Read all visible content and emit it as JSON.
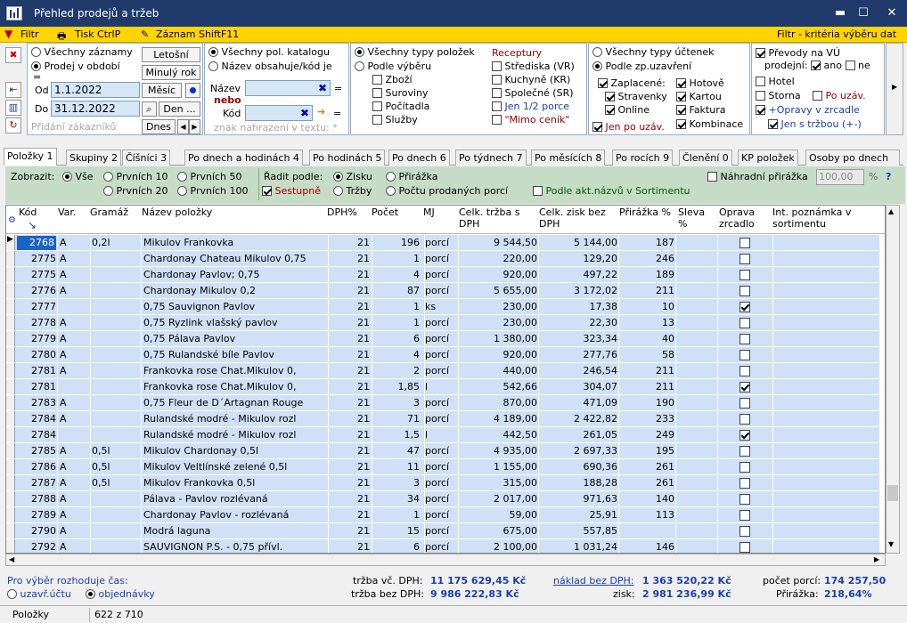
{
  "window": {
    "title": "Přehled prodejů a tržeb",
    "min": "▬",
    "max": "☐",
    "close": "✕"
  },
  "menu": {
    "filter": "Filtr",
    "print": "Tisk CtrlP",
    "record": "Záznam ShiftF11",
    "right": "Filtr - kritéria výběru dat"
  },
  "p1": {
    "all": "Všechny záznamy",
    "period": "Prodej v období",
    "ytd": "Letošní",
    "lastyear": "Minulý rok",
    "month": "Měsíc",
    "day": "Den ...",
    "today": "Dnes",
    "from_label": "Od",
    "to_label": "Do",
    "from": "1.1.2022",
    "to": "31.12.2022",
    "addcust": "Přidání zákazníků",
    "eq": "="
  },
  "p2": {
    "allcat": "Všechny pol. katalogu",
    "contains": "Název obsahuje/kód je",
    "name": "Název",
    "or": "nebo",
    "code": "Kód",
    "hint": "znak nahrazení v textu: *"
  },
  "p3": {
    "alltypes": "Všechny typy položek",
    "bysel": "Podle výběru",
    "goods": "Zboží",
    "raw": "Suroviny",
    "counters": "Počítadla",
    "services": "Služby",
    "recipes": "Receptury",
    "centers": "Střediska (VR)",
    "kitchen": "Kuchyně  (KR)",
    "common": "Společné (SR)",
    "half": "Jen 1/2 porce",
    "offmenu": "\"Mimo ceník\""
  },
  "p4": {
    "allbills": "Všechny typy účtenek",
    "bystate": "Podle zp.uzavření",
    "paid": "Zaplacené:",
    "meal": "Stravenky",
    "online": "Online",
    "cash": "Hotově",
    "card": "Kartou",
    "invoice": "Faktura",
    "combo": "Kombinace",
    "onlybill": "Jen po uzáv."
  },
  "p5": {
    "transfer": "Převody na VÚ",
    "sales": "prodejní:",
    "yes": "ano",
    "no": "ne",
    "hotel": "Hotel",
    "storno": "Storna",
    "after": "Po uzáv.",
    "fixes": "+Opravy v zrcadle",
    "withrev": "Jen s tržbou (+-)"
  },
  "tabs": [
    "Položky 1",
    "Skupiny 2",
    "Číšníci 3",
    "Po dnech a hodinách 4",
    "Po hodinách 5",
    "Po dnech 6",
    "Po týdnech 7",
    "Po měsících 8",
    "Po rocích 9",
    "Členění 0",
    "KP položek",
    "Osoby po dnech"
  ],
  "options": {
    "show": "Zobrazit:",
    "all": "Vše",
    "f10": "Prvních 10",
    "f20": "Prvních 20",
    "f50": "Prvních 50",
    "f100": "Prvních 100",
    "sort": "Řadit podle:",
    "desc": "Sestupně",
    "profit": "Zisku",
    "rev": "Tržby",
    "markup": "Přirážka",
    "count": "Počtu prodaných porcí",
    "actual": "Podle akt.názvů v Sortimentu",
    "altmarkup": "Náhradní přirážka",
    "altval": "100,00",
    "pct": "%",
    "help": "?"
  },
  "columns": [
    "Kód",
    "Var.",
    "Gramáž",
    "Název položky",
    "DPH%",
    "Počet",
    "MJ",
    "Celk. tržba s DPH",
    "Celk. zisk bez DPH",
    "Přirážka %",
    "Sleva %",
    "Oprava zrcadlo",
    "Int. poznámka v sortimentu"
  ],
  "rows": [
    [
      "2768",
      "A",
      "0,2l",
      "Mikulov Frankovka",
      "21",
      "196",
      "porcí",
      "9 544,50",
      "5 144,00",
      "187",
      "",
      false
    ],
    [
      "2775",
      "A",
      "",
      "Chardonay Chateau Mikulov 0,75",
      "21",
      "1",
      "porcí",
      "220,00",
      "129,20",
      "246",
      "",
      false
    ],
    [
      "2775",
      "A",
      "",
      "Chardonay Pavlov; 0,75",
      "21",
      "4",
      "porcí",
      "920,00",
      "497,22",
      "189",
      "",
      false
    ],
    [
      "2776",
      "A",
      "",
      "Chardonay Mikulov 0,2",
      "21",
      "87",
      "porcí",
      "5 655,00",
      "3 172,02",
      "211",
      "",
      false
    ],
    [
      "2777",
      "",
      "",
      "0,75 Sauvignon Pavlov",
      "21",
      "1",
      "ks",
      "230,00",
      "17,38",
      "10",
      "",
      true
    ],
    [
      "2778",
      "A",
      "",
      "0,75 Ryzlink vlašský pavlov",
      "21",
      "1",
      "porcí",
      "230,00",
      "22,30",
      "13",
      "",
      false
    ],
    [
      "2779",
      "A",
      "",
      "0,75 Pálava Pavlov",
      "21",
      "6",
      "porcí",
      "1 380,00",
      "323,34",
      "40",
      "",
      false
    ],
    [
      "2780",
      "A",
      "",
      "0,75 Rulandské bíle Pavlov",
      "21",
      "4",
      "porcí",
      "920,00",
      "277,76",
      "58",
      "",
      false
    ],
    [
      "2781",
      "A",
      "",
      "Frankovka rose Chat.Mikulov 0,",
      "21",
      "2",
      "porcí",
      "440,00",
      "246,54",
      "211",
      "",
      false
    ],
    [
      "2781",
      "",
      "",
      "Frankovka rose Chat.Mikulov 0,",
      "21",
      "1,85",
      "l",
      "542,66",
      "304,07",
      "211",
      "",
      true
    ],
    [
      "2783",
      "A",
      "",
      "0,75 Fleur de D´Artagnan Rouge",
      "21",
      "3",
      "porcí",
      "870,00",
      "471,09",
      "190",
      "",
      false
    ],
    [
      "2784",
      "A",
      "",
      "Rulandské modré - Mikulov rozl",
      "21",
      "71",
      "porcí",
      "4 189,00",
      "2 422,82",
      "233",
      "",
      false
    ],
    [
      "2784",
      "",
      "",
      "Rulandské modré - Mikulov rozl",
      "21",
      "1,5",
      "l",
      "442,50",
      "261,05",
      "249",
      "",
      true
    ],
    [
      "2785",
      "A",
      "0,5l",
      "Mikulov Chardonay 0,5l",
      "21",
      "47",
      "porcí",
      "4 935,00",
      "2 697,33",
      "195",
      "",
      false
    ],
    [
      "2786",
      "A",
      "0,5l",
      "Mikulov Veltlínské zelené 0,5l",
      "21",
      "11",
      "porcí",
      "1 155,00",
      "690,36",
      "261",
      "",
      false
    ],
    [
      "2787",
      "A",
      "0,5l",
      "Mikulov Frankovka 0,5l",
      "21",
      "3",
      "porcí",
      "315,00",
      "188,28",
      "261",
      "",
      false
    ],
    [
      "2788",
      "A",
      "",
      "Pálava - Pavlov rozlévaná",
      "21",
      "34",
      "porcí",
      "2 017,00",
      "971,63",
      "140",
      "",
      false
    ],
    [
      "2789",
      "A",
      "",
      "Chardonay Pavlov - rozlévaná",
      "21",
      "1",
      "porcí",
      "59,00",
      "25,91",
      "113",
      "",
      false
    ],
    [
      "2790",
      "A",
      "",
      "Modrá laguna",
      "21",
      "15",
      "porcí",
      "675,00",
      "557,85",
      "",
      "",
      false
    ],
    [
      "2792",
      "A",
      "",
      "SAUVIGNON P.S. - 0,75  přívl.",
      "21",
      "6",
      "porcí",
      "2 100,00",
      "1 031,24",
      "146",
      "",
      false
    ]
  ],
  "footer": {
    "timelabel": "Pro výběr rozhoduje čas:",
    "closed": "uzavř.účtu",
    "ordered": "objednávky",
    "revvat": "tržba vč. DPH:",
    "revvat_v": "11 175 629,45 Kč",
    "revnovat": "tržba bez DPH:",
    "revnovat_v": "9 986 222,83 Kč",
    "cost": "náklad bez DPH:",
    "cost_v": "1 363 520,22 Kč",
    "profit": "zisk:",
    "profit_v": "2 981 236,99 Kč",
    "portions": "počet porcí:",
    "portions_v": "174 257,50",
    "markup": "Přirážka:",
    "markup_v": "218,64%"
  },
  "status": {
    "left": "Položky",
    "count": "622 z 710"
  }
}
